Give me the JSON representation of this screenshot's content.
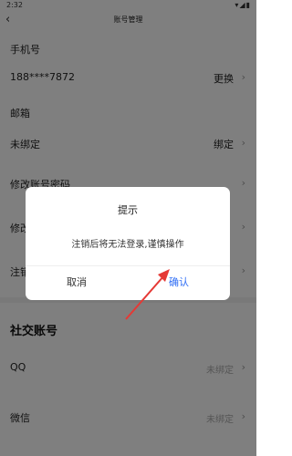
{
  "status_bar": {
    "time": "2:32",
    "icons": [
      "wifi-icon",
      "signal-icon",
      "battery-icon"
    ]
  },
  "header": {
    "title": "账号管理"
  },
  "phone": {
    "label": "手机号",
    "value": "188****7872",
    "action": "更换"
  },
  "email": {
    "label": "邮箱",
    "value": "未绑定",
    "action": "绑定"
  },
  "menu": {
    "change_password": "修改账号密码",
    "item2": "修改",
    "item3": "注销"
  },
  "social": {
    "title": "社交账号",
    "items": [
      {
        "label": "QQ",
        "status": "未绑定"
      },
      {
        "label": "微信",
        "status": "未绑定"
      }
    ]
  },
  "dialog": {
    "title": "提示",
    "message": "注销后将无法登录,谨慎操作",
    "cancel": "取消",
    "confirm": "确认"
  },
  "colors": {
    "accent": "#2f6ef5",
    "annotation_arrow": "#e53935",
    "overlay": "rgba(0,0,0,0.5)"
  }
}
